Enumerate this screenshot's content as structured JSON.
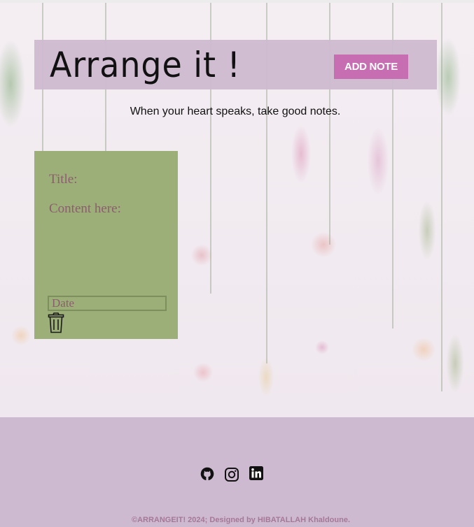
{
  "header": {
    "title": "Arrange it !",
    "add_note_label": "ADD NOTE"
  },
  "tagline": "When your heart speaks, take good notes.",
  "note": {
    "title_placeholder": "Title:",
    "content_placeholder": "Content here:",
    "date_placeholder": "Date",
    "delete_icon": "trash-icon"
  },
  "footer": {
    "social_icons": [
      "github-icon",
      "instagram-icon",
      "linkedin-icon"
    ],
    "copyright": "©ARRANGEIT! 2024; Designed by HIBATALLAH Khaldoune."
  },
  "colors": {
    "header_bg": "#cebad0",
    "accent_button": "#c76db2",
    "note_bg": "#9daf78",
    "note_text": "#8a5e6e",
    "footer_bg": "#cebad0",
    "footer_text": "#a47896"
  }
}
